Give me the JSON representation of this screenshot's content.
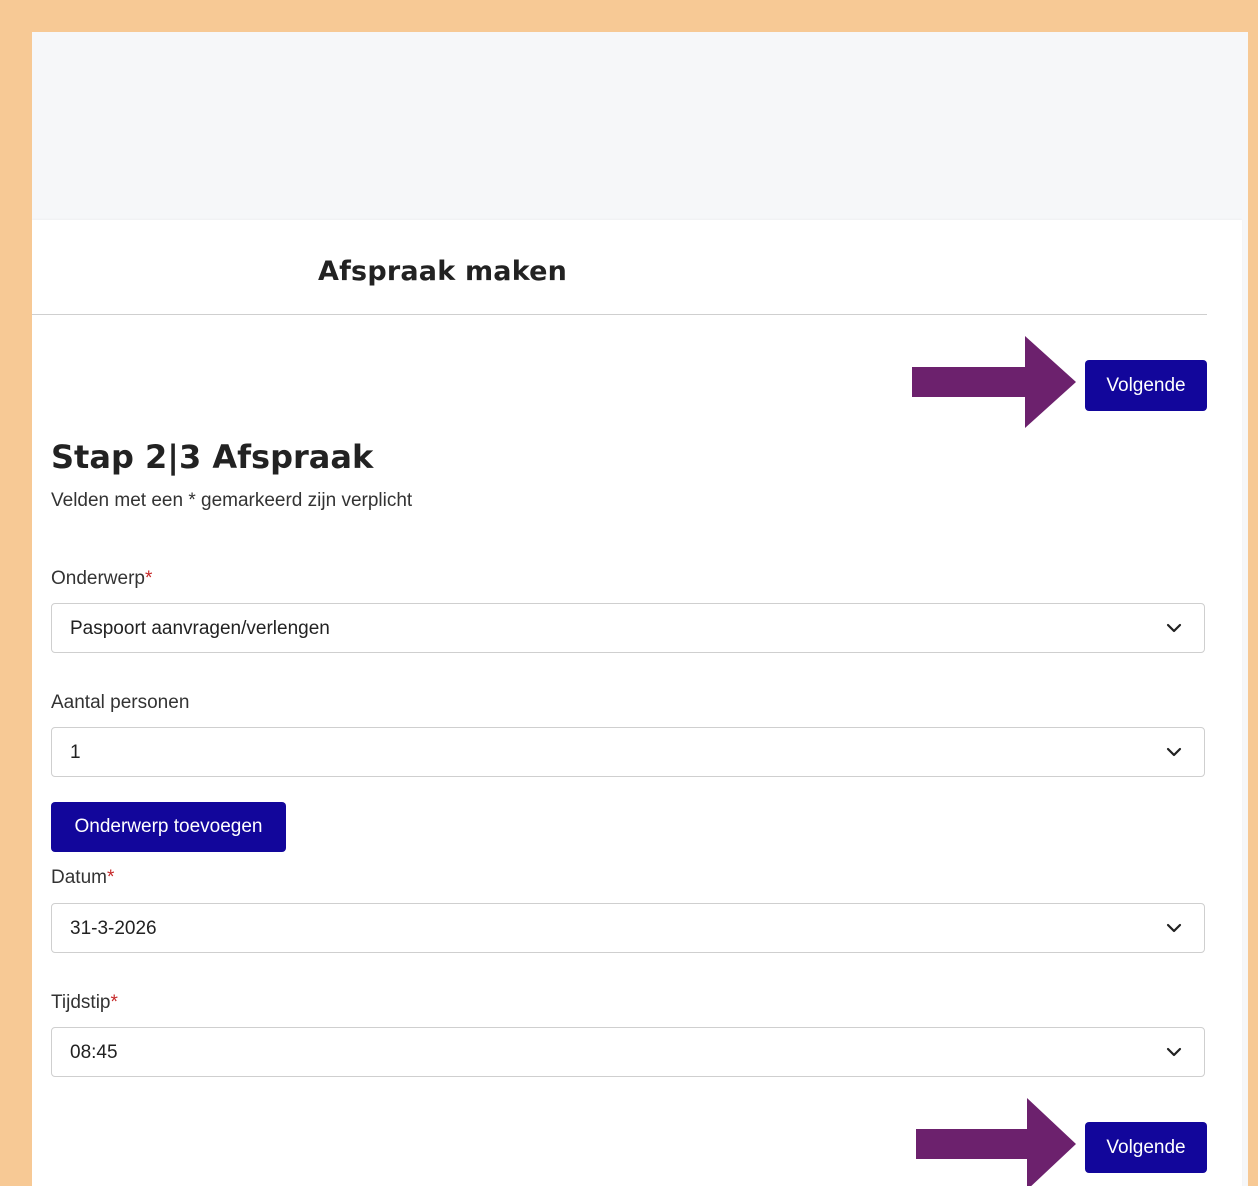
{
  "header": {
    "title": "Afspraak maken"
  },
  "nav": {
    "next_label": "Volgende"
  },
  "step": {
    "title": "Stap 2|3 Afspraak",
    "hint": "Velden met een * gemarkeerd zijn verplicht"
  },
  "required_marker": "*",
  "fields": {
    "subject": {
      "label": "Onderwerp",
      "value": "Paspoort aanvragen/verlengen"
    },
    "persons": {
      "label": "Aantal personen",
      "value": "1"
    },
    "date": {
      "label": "Datum",
      "value": "31-3-2026"
    },
    "time": {
      "label": "Tijdstip",
      "value": "08:45"
    }
  },
  "actions": {
    "add_subject_label": "Onderwerp toevoegen"
  },
  "colors": {
    "accent": "#12069b",
    "frame": "#f7c995",
    "arrow": "#6c216d",
    "required": "#c62828"
  },
  "icons": {
    "select": "chevron-down-icon",
    "pointer": "arrow-right-icon"
  }
}
